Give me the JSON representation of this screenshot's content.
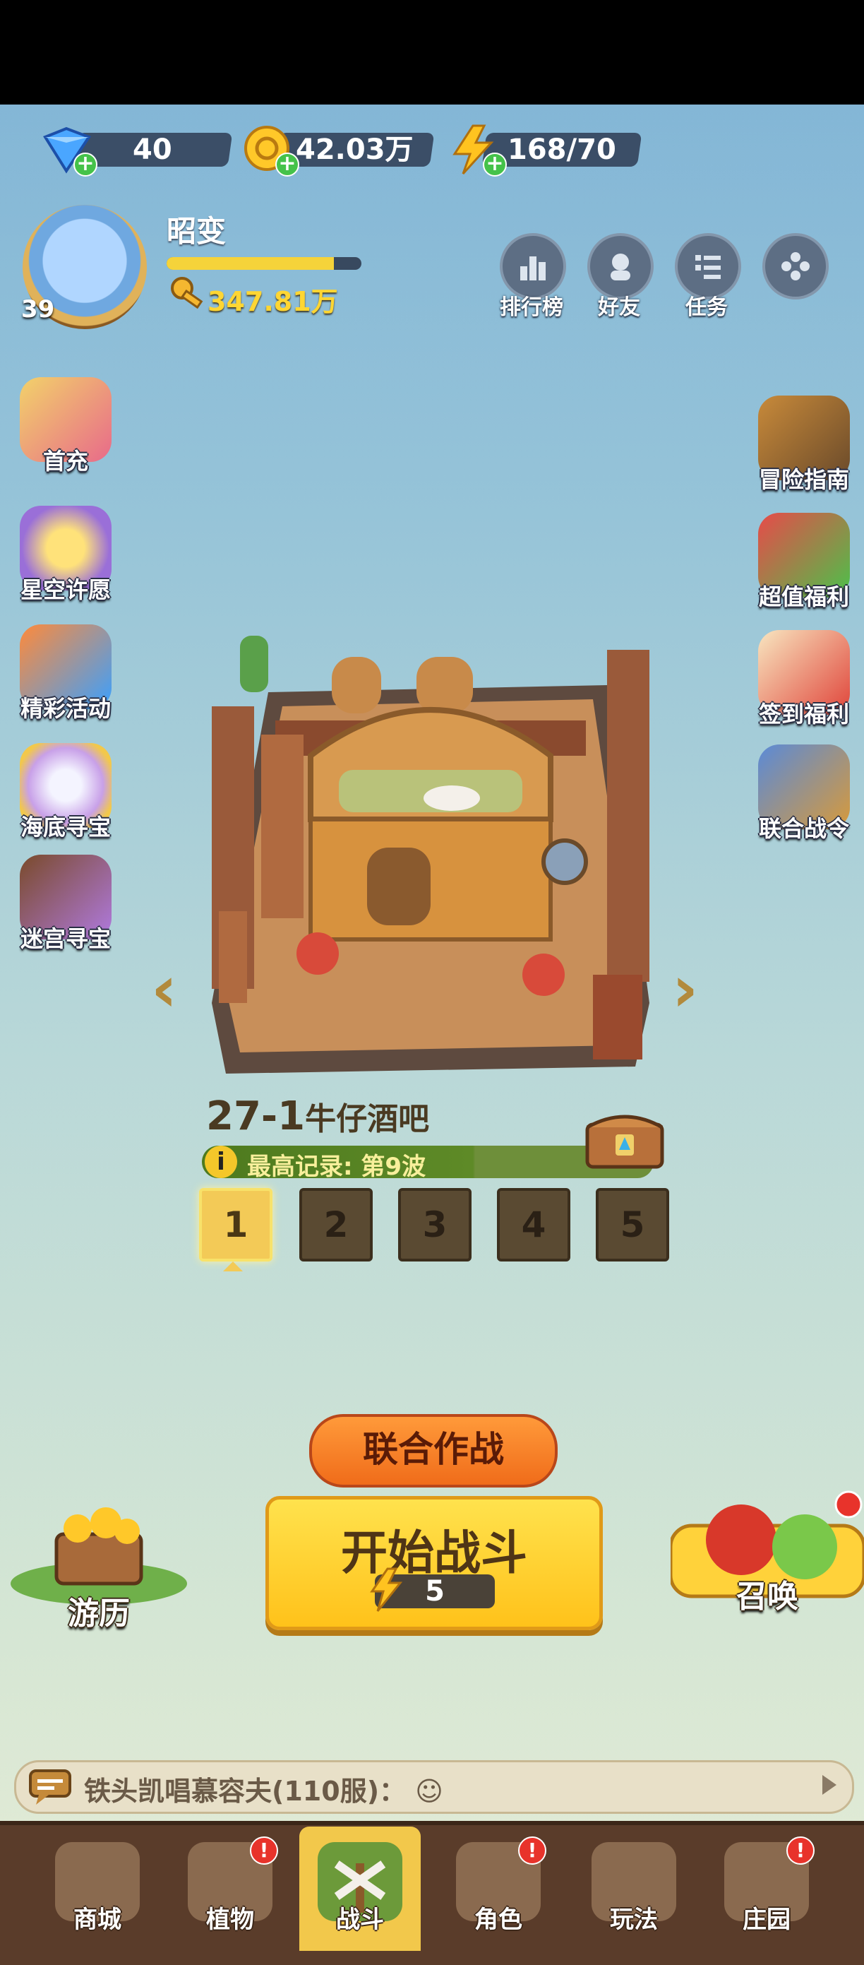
{
  "currencies": {
    "diamond": {
      "value": "40",
      "icon": "diamond-icon"
    },
    "coin": {
      "value": "42.03万",
      "icon": "coin-icon"
    },
    "energy": {
      "value": "168/70",
      "icon": "lightning-icon"
    }
  },
  "profile": {
    "name": "昭变",
    "level": "39",
    "gold": "347.81万",
    "xp_fraction": 0.86
  },
  "top_buttons": [
    {
      "label": "排行榜",
      "icon": "ranking-icon"
    },
    {
      "label": "好友",
      "icon": "friends-icon"
    },
    {
      "label": "任务",
      "icon": "tasks-icon"
    },
    {
      "label": "",
      "icon": "more-icon"
    }
  ],
  "left_features": [
    {
      "label": "首充",
      "icon": "first-charge-icon"
    },
    {
      "label": "星空许愿",
      "icon": "star-wish-icon"
    },
    {
      "label": "精彩活动",
      "icon": "events-icon"
    },
    {
      "label": "海底寻宝",
      "icon": "sea-treasure-icon"
    },
    {
      "label": "迷宫寻宝",
      "icon": "maze-treasure-icon"
    }
  ],
  "right_features": [
    {
      "label": "冒险指南",
      "icon": "guide-icon"
    },
    {
      "label": "超值福利",
      "icon": "value-benefit-icon"
    },
    {
      "label": "签到福利",
      "icon": "checkin-icon"
    },
    {
      "label": "联合战令",
      "icon": "battle-pass-icon"
    }
  ],
  "stage": {
    "number": "27-1",
    "name": "牛仔酒吧",
    "record_info": "i",
    "record": "最高记录: 第9波",
    "waves": [
      "1",
      "2",
      "3",
      "4",
      "5"
    ],
    "selected_wave": "1"
  },
  "actions": {
    "coop": "联合作战",
    "start": "开始战斗",
    "start_cost": "5",
    "journey": "游历",
    "summon": "召唤"
  },
  "chat": {
    "text": "铁头凯唱慕容夫(110服)：",
    "emoji": "☺"
  },
  "nav": [
    {
      "label": "商城",
      "icon": "shop-icon",
      "badge": false
    },
    {
      "label": "植物",
      "icon": "plants-icon",
      "badge": true
    },
    {
      "label": "战斗",
      "icon": "battle-icon",
      "badge": false,
      "active": true
    },
    {
      "label": "角色",
      "icon": "character-icon",
      "badge": true
    },
    {
      "label": "玩法",
      "icon": "gameplay-icon",
      "badge": false
    },
    {
      "label": "庄园",
      "icon": "manor-icon",
      "badge": true
    }
  ],
  "colors": {
    "accent": "#ffc21a",
    "coop": "#f06c1a",
    "record": "#5e8a27",
    "nav": "#5a3c2a"
  }
}
